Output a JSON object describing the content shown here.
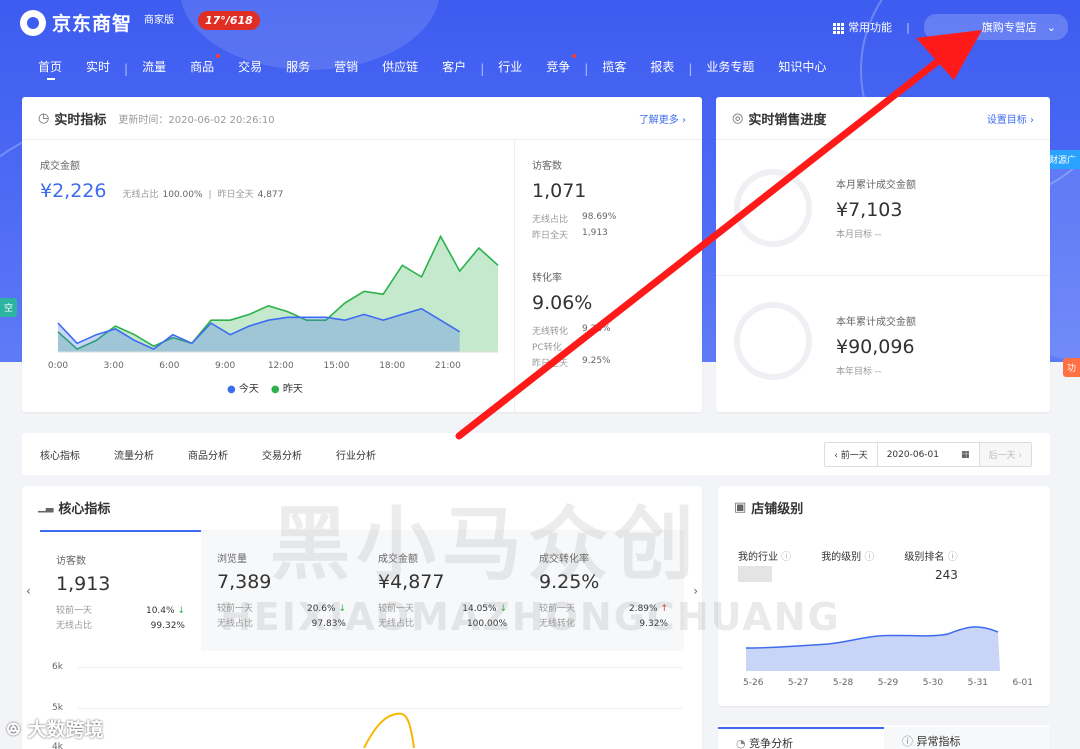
{
  "header": {
    "brand": "京东商智",
    "edition": "商家版",
    "promo_badge": "17°/618",
    "common_functions": "常用功能",
    "separator": "|",
    "shop_name": "旗购专营店"
  },
  "nav": [
    "首页",
    "实时",
    "流量",
    "商品",
    "交易",
    "服务",
    "营销",
    "供应链",
    "客户",
    "行业",
    "竞争",
    "揽客",
    "报表",
    "业务专题",
    "知识中心"
  ],
  "realtime": {
    "title": "实时指标",
    "update_label": "更新时间：2020-06-02 20:26:10",
    "more": "了解更多 ›",
    "gmv_label": "成交金额",
    "gmv_value": "¥2,226",
    "wireless_label": "无线占比",
    "wireless_value": "100.00%",
    "yesterday_label": "昨日全天",
    "yesterday_value": "4,877",
    "legend_today": "今天",
    "legend_yesterday": "昨天",
    "visitors_label": "访客数",
    "visitors_value": "1,071",
    "visitors_wireless_label": "无线占比",
    "visitors_wireless_value": "98.69%",
    "visitors_yday_label": "昨日全天",
    "visitors_yday_value": "1,913",
    "conv_label": "转化率",
    "conv_value": "9.06%",
    "conv_wireless_label": "无线转化",
    "conv_wireless_value": "9.28%",
    "conv_pc_label": "PC转化",
    "conv_pc_value": "-",
    "conv_yday_label": "昨日全天",
    "conv_yday_value": "9.25%"
  },
  "chart_data": {
    "type": "area",
    "x": [
      "0:00",
      "3:00",
      "6:00",
      "9:00",
      "12:00",
      "15:00",
      "18:00",
      "21:00"
    ],
    "series": [
      {
        "name": "今天",
        "color": "#3d6cf0",
        "values": [
          [
            0,
            20
          ],
          [
            1,
            6
          ],
          [
            2,
            12
          ],
          [
            3,
            16
          ],
          [
            4,
            8
          ],
          [
            5,
            2
          ],
          [
            6,
            12
          ],
          [
            7,
            6
          ],
          [
            8,
            20
          ],
          [
            9,
            12
          ],
          [
            10,
            18
          ],
          [
            11,
            22
          ],
          [
            12,
            24
          ],
          [
            13,
            24
          ],
          [
            14,
            24
          ],
          [
            15,
            22
          ],
          [
            16,
            26
          ],
          [
            17,
            22
          ],
          [
            18,
            26
          ],
          [
            19,
            30
          ],
          [
            20,
            22
          ],
          [
            21,
            14
          ]
        ]
      },
      {
        "name": "昨天",
        "color": "#2db14a",
        "values": [
          [
            0,
            14
          ],
          [
            1,
            2
          ],
          [
            2,
            8
          ],
          [
            3,
            18
          ],
          [
            4,
            12
          ],
          [
            5,
            4
          ],
          [
            6,
            10
          ],
          [
            7,
            6
          ],
          [
            8,
            22
          ],
          [
            9,
            22
          ],
          [
            10,
            26
          ],
          [
            11,
            32
          ],
          [
            12,
            28
          ],
          [
            13,
            22
          ],
          [
            14,
            22
          ],
          [
            15,
            34
          ],
          [
            16,
            42
          ],
          [
            17,
            40
          ],
          [
            18,
            60
          ],
          [
            19,
            52
          ],
          [
            20,
            80
          ],
          [
            21,
            56
          ],
          [
            22,
            72
          ],
          [
            23,
            60
          ]
        ]
      }
    ]
  },
  "sales": {
    "title": "实时销售进度",
    "setting": "设置目标 ›",
    "month_label": "本月累计成交金额",
    "month_value": "¥7,103",
    "month_target": "本月目标 --",
    "year_label": "本年累计成交金额",
    "year_value": "¥90,096",
    "year_target": "本年目标 --"
  },
  "tabs": [
    "核心指标",
    "流量分析",
    "商品分析",
    "交易分析",
    "行业分析"
  ],
  "datepicker": {
    "prev": "‹ 前一天",
    "date": "2020-06-01",
    "next": "后一天 ›"
  },
  "core": {
    "title": "核心指标",
    "metrics": [
      {
        "name": "访客数",
        "value": "1,913",
        "cmp_label": "较前一天",
        "cmp_value": "10.4%",
        "dir": "down",
        "sub_label": "无线占比",
        "sub_value": "99.32%"
      },
      {
        "name": "浏览量",
        "value": "7,389",
        "cmp_label": "较前一天",
        "cmp_value": "20.6%",
        "dir": "down",
        "sub_label": "无线占比",
        "sub_value": "97.83%"
      },
      {
        "name": "成交金额",
        "value": "¥4,877",
        "cmp_label": "较前一天",
        "cmp_value": "14.05%",
        "dir": "down",
        "sub_label": "无线占比",
        "sub_value": "100.00%"
      },
      {
        "name": "成交转化率",
        "value": "9.25%",
        "cmp_label": "较前一天",
        "cmp_value": "2.89%",
        "dir": "up",
        "sub_label": "无线转化",
        "sub_value": "9.32%"
      }
    ],
    "y_ticks": [
      "6k",
      "5k",
      "4k"
    ]
  },
  "shop_level": {
    "title": "店铺级别",
    "industry_label": "我的行业",
    "level_label": "我的级别",
    "rank_label": "级别排名",
    "rank_value": "243",
    "x_ticks": [
      "5-26",
      "5-27",
      "5-28",
      "5-29",
      "5-30",
      "5-31",
      "6-01"
    ]
  },
  "bottom_tabs": [
    "竞争分析",
    "异常指标"
  ],
  "watermark": {
    "cn": "黑小马众创",
    "en": "HEIXIAOMAZHONGCHUANG"
  },
  "footer_logo": "大数跨境",
  "side_tags": [
    "财源广",
    "空",
    "功"
  ],
  "colors": {
    "brand": "#3d5cf0",
    "arrow": "#ff1a1a",
    "today": "#3d6cf0",
    "yesterday": "#2db14a"
  }
}
